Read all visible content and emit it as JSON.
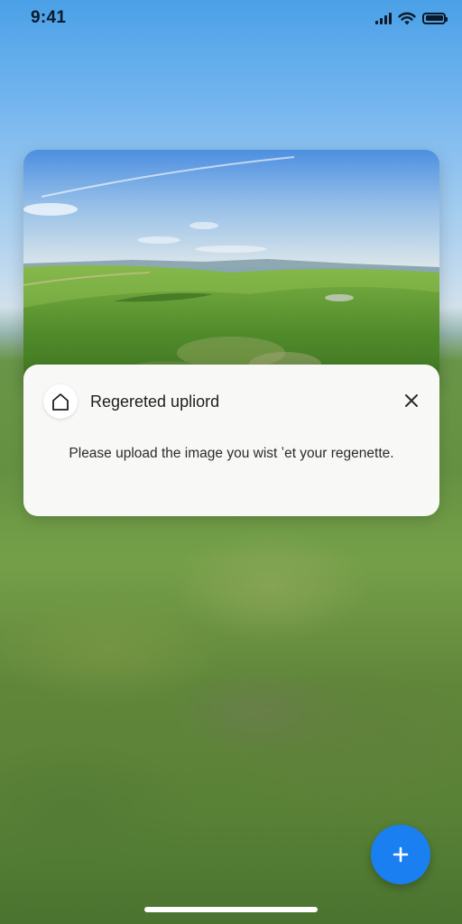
{
  "status_bar": {
    "time": "9:41",
    "icons": [
      "signal-icon",
      "wifi-icon",
      "battery-icon"
    ]
  },
  "photo": {
    "description_icon": "landscape-photo"
  },
  "dialog": {
    "icon": "home-icon",
    "title": "Regereted upliord",
    "message": "Please upload the image you wist ʼet your regenette.",
    "close_icon": "close-icon"
  },
  "fab": {
    "icon": "plus-icon",
    "color": "#1a7ff0"
  },
  "colors": {
    "accent": "#1a7ff0",
    "dialog_bg": "#f8f8f6"
  }
}
